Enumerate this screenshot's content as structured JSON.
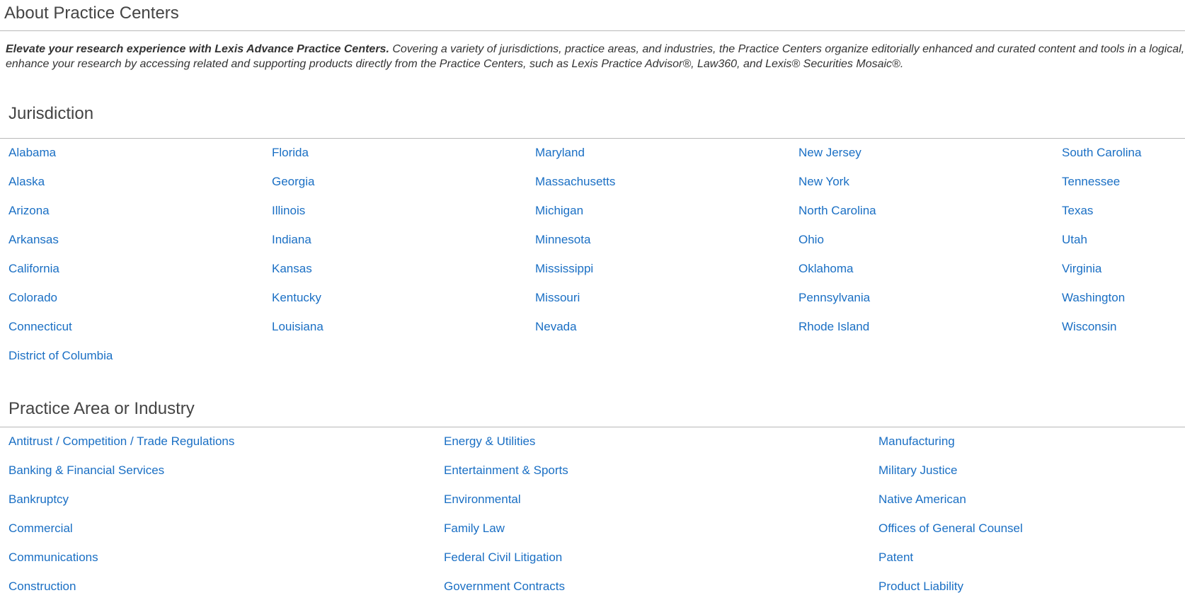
{
  "page_title": "About Practice Centers",
  "intro": {
    "lead": "Elevate your research experience with Lexis Advance Practice Centers.",
    "line1_rest": " Covering a variety of jurisdictions, practice areas, and industries, the Practice Centers organize editorially enhanced and curated content and tools in a logical, easy-to",
    "line2": "enhance your research by accessing related and supporting products directly from the Practice Centers, such as Lexis Practice Advisor®, Law360, and Lexis® Securities Mosaic®."
  },
  "jurisdiction": {
    "title": "Jurisdiction",
    "columns": [
      [
        "Alabama",
        "Alaska",
        "Arizona",
        "Arkansas",
        "California",
        "Colorado",
        "Connecticut",
        "District of Columbia"
      ],
      [
        "Florida",
        "Georgia",
        "Illinois",
        "Indiana",
        "Kansas",
        "Kentucky",
        "Louisiana"
      ],
      [
        "Maryland",
        "Massachusetts",
        "Michigan",
        "Minnesota",
        "Mississippi",
        "Missouri",
        "Nevada"
      ],
      [
        "New Jersey",
        "New York",
        "North Carolina",
        "Ohio",
        "Oklahoma",
        "Pennsylvania",
        "Rhode Island"
      ],
      [
        "South Carolina",
        "Tennessee",
        "Texas",
        "Utah",
        "Virginia",
        "Washington",
        "Wisconsin"
      ]
    ]
  },
  "practice_area": {
    "title": "Practice Area or Industry",
    "columns": [
      [
        "Antitrust / Competition / Trade Regulations",
        "Banking & Financial Services",
        "Bankruptcy",
        "Commercial",
        "Communications",
        "Construction"
      ],
      [
        "Energy & Utilities",
        "Entertainment & Sports",
        "Environmental",
        "Family Law",
        "Federal Civil Litigation",
        "Government Contracts"
      ],
      [
        "Manufacturing",
        "Military Justice",
        "Native American",
        "Offices of General Counsel",
        "Patent",
        "Product Liability"
      ]
    ]
  },
  "colors": {
    "link": "#1a6fc4",
    "heading": "#444444",
    "rule": "#b8b8b8"
  }
}
